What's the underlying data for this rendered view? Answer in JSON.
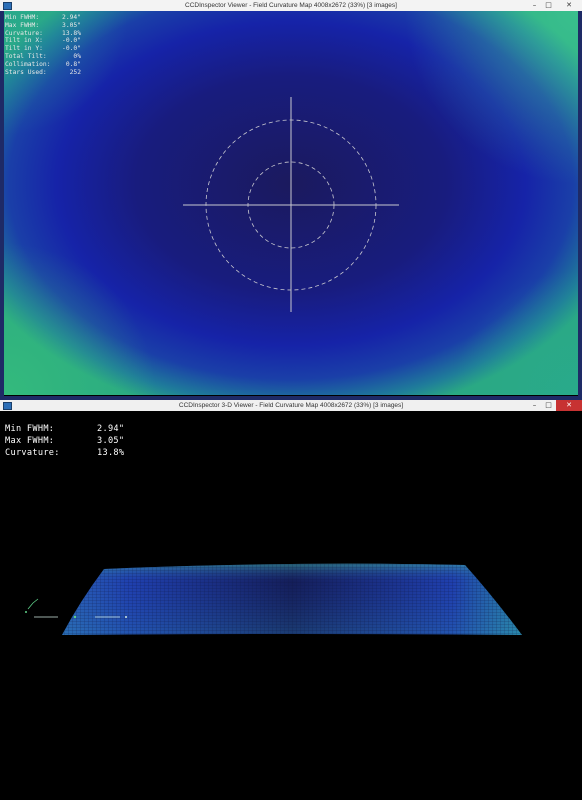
{
  "windows": {
    "map": {
      "title": "CCDInspector Viewer - Field Curvature Map 4008x2672 (33%) [3 images]",
      "buttons": {
        "minimize": "–",
        "maximize": "□",
        "close": "✕"
      },
      "stats": [
        {
          "label": "Min FWHM:",
          "value": "2.94\""
        },
        {
          "label": "Max FWHM:",
          "value": "3.05\""
        },
        {
          "label": "Curvature:",
          "value": "13.8%"
        },
        {
          "label": "Tilt in X:",
          "value": "-0.0\""
        },
        {
          "label": "Tilt in Y:",
          "value": "-0.0\""
        },
        {
          "label": "Total Tilt:",
          "value": "0%"
        },
        {
          "label": "Collimation:",
          "value": "0.8\""
        },
        {
          "label": "Stars Used:",
          "value": "252"
        }
      ]
    },
    "viewer3d": {
      "title": "CCDInspector 3-D Viewer - Field Curvature Map 4008x2672 (33%) [3 images]",
      "buttons": {
        "minimize": "–",
        "maximize": "□",
        "close": "✕"
      },
      "stats": [
        {
          "label": "Min FWHM:",
          "value": "2.94\""
        },
        {
          "label": "Max FWHM:",
          "value": "3.05\""
        },
        {
          "label": "Curvature:",
          "value": "13.8%"
        }
      ]
    }
  },
  "colors": {
    "map_center": "#1b1a5e",
    "map_mid": "#1623a8",
    "map_edge": "#2aa982",
    "close_button": "#c73232"
  }
}
